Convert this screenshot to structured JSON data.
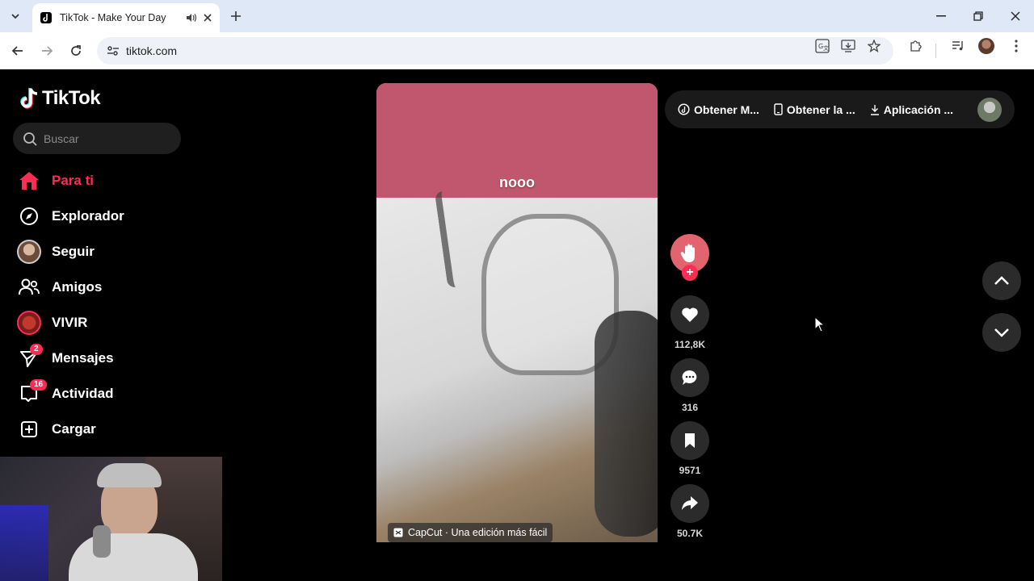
{
  "browser": {
    "tab_title": "TikTok - Make Your Day",
    "url": "tiktok.com"
  },
  "sidebar": {
    "logo_text": "TikTok",
    "search_placeholder": "Buscar",
    "items": [
      {
        "label": "Para ti",
        "icon": "home-icon",
        "active": true
      },
      {
        "label": "Explorador",
        "icon": "compass-icon"
      },
      {
        "label": "Seguir",
        "icon": "following-avatar"
      },
      {
        "label": "Amigos",
        "icon": "friends-icon"
      },
      {
        "label": "VIVIR",
        "icon": "live-avatar"
      },
      {
        "label": "Mensajes",
        "icon": "messages-icon",
        "badge": "2"
      },
      {
        "label": "Actividad",
        "icon": "activity-icon",
        "badge": "16"
      },
      {
        "label": "Cargar",
        "icon": "upload-icon"
      }
    ]
  },
  "video": {
    "caption": "nooo",
    "capcut_label": "CapCut · Una edición más fácil"
  },
  "actions": {
    "likes": "112,8K",
    "comments": "316",
    "saves": "9571",
    "shares": "50.7K"
  },
  "topbar": {
    "links": [
      {
        "label": "Obtener M...",
        "icon": "tiktok-coin-icon"
      },
      {
        "label": "Obtener la ...",
        "icon": "phone-icon"
      },
      {
        "label": "Aplicación ...",
        "icon": "download-icon"
      }
    ]
  },
  "colors": {
    "accent": "#fe2c55",
    "background": "#000000",
    "video_top": "#c1576f"
  }
}
